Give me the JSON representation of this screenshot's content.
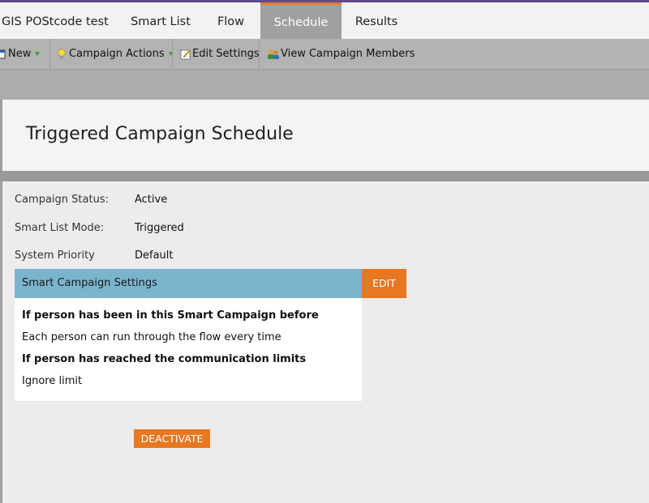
{
  "tabs": [
    {
      "label": "GIS POStcode test"
    },
    {
      "label": "Smart List"
    },
    {
      "label": "Flow"
    },
    {
      "label": "Schedule",
      "active": true
    },
    {
      "label": "Results"
    }
  ],
  "toolbar": {
    "new_label": "New",
    "campaign_actions_label": "Campaign Actions",
    "edit_settings_label": "Edit Settings",
    "view_members_label": "View Campaign Members",
    "icons": [
      "page-icon",
      "lightbulb-icon",
      "edit-settings-icon",
      "members-icon"
    ]
  },
  "page": {
    "title": "Triggered Campaign Schedule"
  },
  "fields": [
    {
      "label": "Campaign Status:",
      "value": "Active"
    },
    {
      "label": "Smart List Mode:",
      "value": "Triggered"
    },
    {
      "label": "System Priority",
      "value": "Default"
    }
  ],
  "settings": {
    "title": "Smart Campaign Settings",
    "edit_label": "EDIT",
    "q1": "If person has been in this Smart Campaign before",
    "a1": "Each person can run through the flow every time",
    "q2": "If person has reached the communication limits",
    "a2": "Ignore limit"
  },
  "actions": {
    "deactivate_label": "DEACTIVATE"
  },
  "colors": {
    "accent": "#e87722",
    "settings_header": "#7ab4cd",
    "top_line": "#5e4b8b"
  }
}
